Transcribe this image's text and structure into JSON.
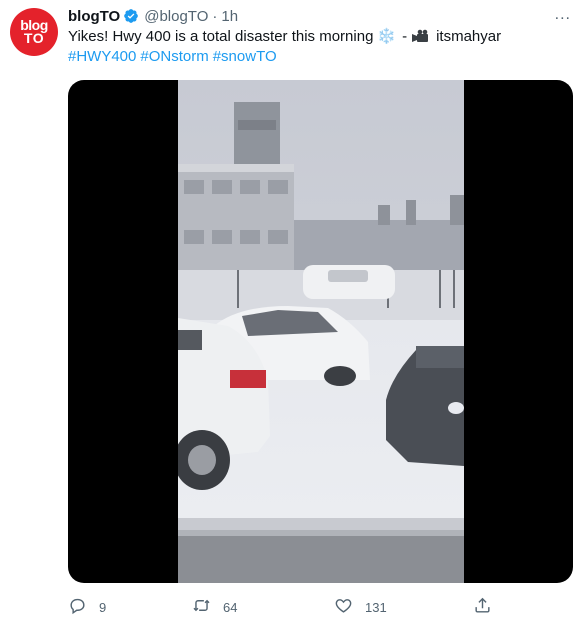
{
  "tweet": {
    "author": {
      "name": "blogTO",
      "handle": "@blogTO",
      "avatar_line1": "blog",
      "avatar_line2": "TO",
      "verified": true
    },
    "separator": "·",
    "time": "1h",
    "more_icon": "...",
    "text_line1": "Yikes! Hwy 400 is a total disaster this morning",
    "snow_emoji": "❄️",
    "dash": "-",
    "camera_icon": "video-camera-icon",
    "credit": "itsmahyar",
    "hashtags": [
      "#HWY400",
      "#ONstorm",
      "#snowTO"
    ],
    "media": {
      "type": "video",
      "description_icon": "snowy-highway-video"
    },
    "actions": {
      "reply_count": "9",
      "retweet_count": "64",
      "like_count": "131"
    }
  },
  "colors": {
    "brand_red": "#e4222b",
    "link_blue": "#1d9bf0",
    "muted": "#536471"
  }
}
